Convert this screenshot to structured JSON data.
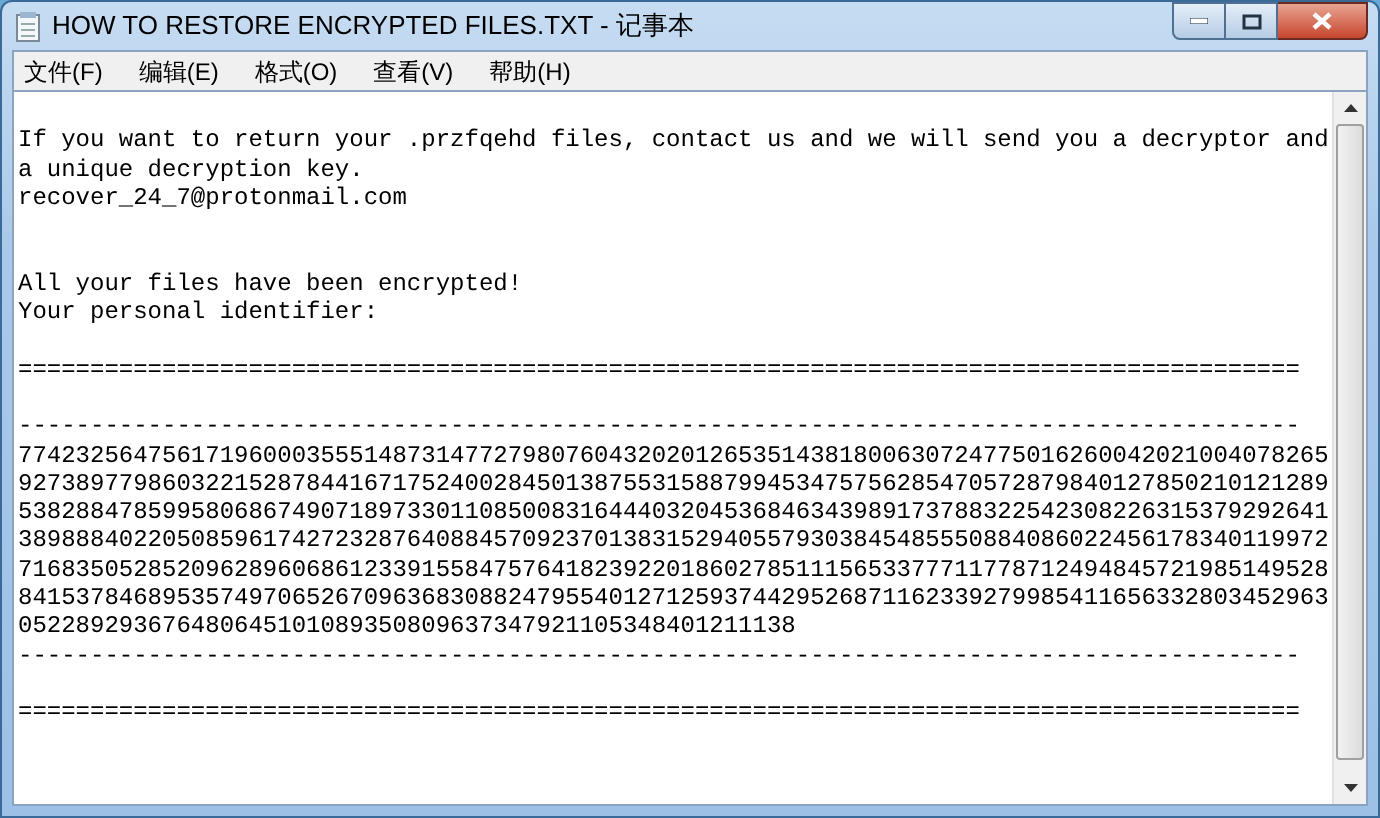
{
  "window": {
    "title": "HOW TO RESTORE ENCRYPTED FILES.TXT - 记事本"
  },
  "menu": [
    {
      "label": "文件(F)"
    },
    {
      "label": "编辑(E)"
    },
    {
      "label": "格式(O)"
    },
    {
      "label": "查看(V)"
    },
    {
      "label": "帮助(H)"
    }
  ],
  "document": {
    "lines": [
      {
        "kind": "blank"
      },
      {
        "kind": "text",
        "text": "If you want to return your .przfqehd files, contact us and we will send you a decryptor and"
      },
      {
        "kind": "text",
        "text": "a unique decryption key."
      },
      {
        "kind": "text",
        "text": "recover_24_7@protonmail.com"
      },
      {
        "kind": "blank"
      },
      {
        "kind": "blank"
      },
      {
        "kind": "text",
        "text": "All your files have been encrypted!"
      },
      {
        "kind": "text",
        "text": "Your personal identifier:"
      },
      {
        "kind": "blank"
      },
      {
        "kind": "text",
        "text": "========================================================================================="
      },
      {
        "kind": "blank"
      },
      {
        "kind": "text",
        "text": "-----------------------------------------------------------------------------------------"
      },
      {
        "kind": "text",
        "text": "7742325647561719600035551487314772798076043202012653514381800630724775016260042021004078265"
      },
      {
        "kind": "text",
        "text": "9273897798603221528784416717524002845013875531588799453475756285470572879840127850210121289"
      },
      {
        "kind": "text",
        "text": "5382884785995806867490718973301108500831644403204536846343989173788322542308226315379292641"
      },
      {
        "kind": "text",
        "text": "3898884022050859617427232876408845709237013831529405579303845485550884086022456178340119972"
      },
      {
        "kind": "text",
        "text": "7168350528520962896068612339155847576418239220186027851115653377711778712494845721985149528"
      },
      {
        "kind": "text",
        "text": "8415378468953574970652670963683088247955401271259374429526871162339279985411656332803452963"
      },
      {
        "kind": "text",
        "text": "052289293676480645101089350809637347921105348401211138"
      },
      {
        "kind": "text",
        "text": "-----------------------------------------------------------------------------------------"
      },
      {
        "kind": "blank"
      },
      {
        "kind": "text",
        "text": "========================================================================================="
      }
    ]
  }
}
